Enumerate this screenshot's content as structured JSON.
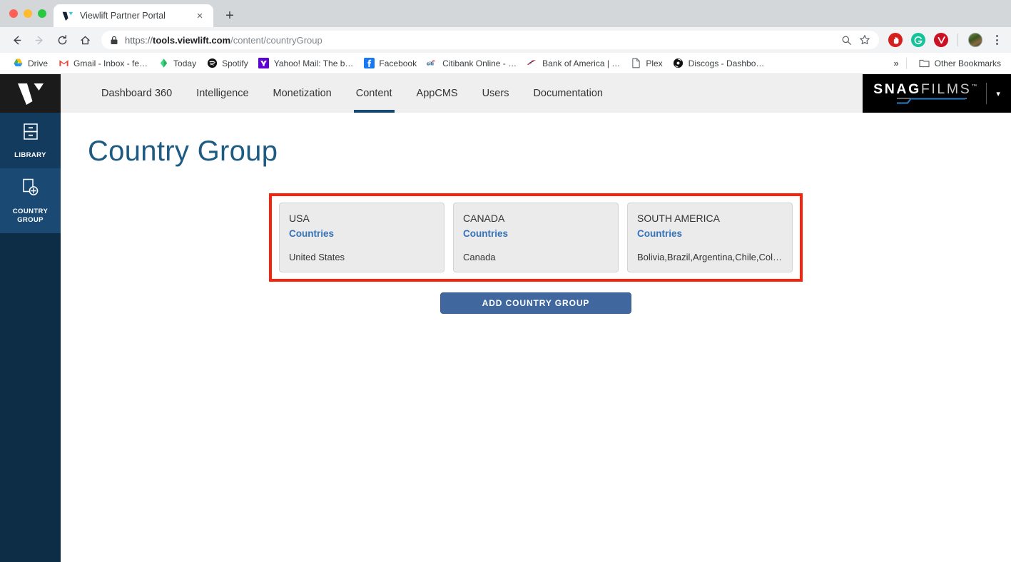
{
  "browser": {
    "window_controls": [
      "close",
      "minimize",
      "maximize"
    ],
    "tab": {
      "title": "Viewlift Partner Portal",
      "favicon": "viewlift-v-icon",
      "close_label": "×"
    },
    "new_tab_label": "+",
    "nav": {
      "back": "←",
      "forward": "→",
      "reload": "⟳",
      "home": "⌂"
    },
    "omnibox": {
      "scheme": "https://",
      "domain": "tools.viewlift.com",
      "path": "/content/countryGroup",
      "full_url": "https://tools.viewlift.com/content/countryGroup",
      "secure": true,
      "zoom_icon": "search-icon",
      "bookmark_icon": "star-icon"
    },
    "extensions": [
      {
        "name": "adblock-extension",
        "glyph": "✋",
        "color": "#d62020"
      },
      {
        "name": "grammarly-extension",
        "glyph": "G",
        "color": "#15c39a"
      },
      {
        "name": "checkmark-extension",
        "glyph": "✓",
        "color": "#cc1122"
      }
    ],
    "profile": "user-avatar",
    "menu": "browser-menu",
    "bookmarks": [
      {
        "label": "Drive",
        "icon": "drive-icon"
      },
      {
        "label": "Gmail - Inbox - fe…",
        "icon": "gmail-icon"
      },
      {
        "label": "Today",
        "icon": "today-icon"
      },
      {
        "label": "Spotify",
        "icon": "spotify-icon"
      },
      {
        "label": "Yahoo! Mail: The b…",
        "icon": "yahoo-icon"
      },
      {
        "label": "Facebook",
        "icon": "facebook-icon"
      },
      {
        "label": "Citibank Online - …",
        "icon": "citi-icon"
      },
      {
        "label": "Bank of America | …",
        "icon": "bofa-icon"
      },
      {
        "label": "Plex",
        "icon": "document-icon"
      },
      {
        "label": "Discogs - Dashbo…",
        "icon": "discogs-icon"
      }
    ],
    "bookmarks_overflow": "»",
    "other_bookmarks": {
      "label": "Other Bookmarks",
      "icon": "folder-icon"
    }
  },
  "sidebar": {
    "logo": "viewlift-v-logo",
    "items": [
      {
        "label": "LIBRARY",
        "icon": "library-cabinet-icon",
        "active": false
      },
      {
        "label": "COUNTRY\nGROUP",
        "label_line1": "COUNTRY",
        "label_line2": "GROUP",
        "icon": "add-page-icon",
        "active": true
      }
    ]
  },
  "navbar": {
    "items": [
      {
        "label": "Dashboard 360",
        "active": false
      },
      {
        "label": "Intelligence",
        "active": false
      },
      {
        "label": "Monetization",
        "active": false
      },
      {
        "label": "Content",
        "active": true
      },
      {
        "label": "AppCMS",
        "active": false
      },
      {
        "label": "Users",
        "active": false
      },
      {
        "label": "Documentation",
        "active": false
      }
    ],
    "active_underline_color": "#16496c"
  },
  "brand": {
    "name_bold": "SNAG",
    "name_light": "FILMS",
    "trademark": "™",
    "caret": "▾"
  },
  "page": {
    "title": "Country Group",
    "title_color": "#1d5b82",
    "highlight_color": "#f7230d",
    "cards_label": "Countries",
    "cards": [
      {
        "name": "USA",
        "sub": "Countries",
        "countries": "United States"
      },
      {
        "name": "CANADA",
        "sub": "Countries",
        "countries": "Canada"
      },
      {
        "name": "SOUTH AMERICA",
        "sub": "Countries",
        "countries": "Bolivia,Brazil,Argentina,Chile,Colo…"
      }
    ],
    "add_button": {
      "label": "ADD COUNTRY GROUP",
      "color": "#41689e"
    }
  }
}
